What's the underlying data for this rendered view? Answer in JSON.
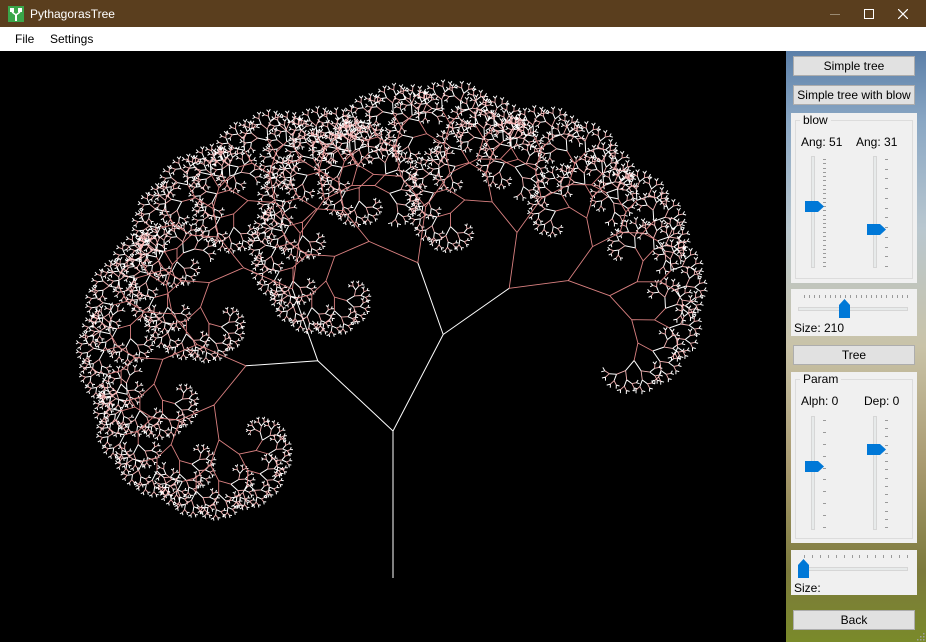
{
  "window": {
    "title": "PythagorasTree",
    "icon": "tree-app-icon",
    "controls": [
      "minimize-icon",
      "maximize-icon",
      "close-icon"
    ]
  },
  "menu": {
    "file": "File",
    "settings": "Settings"
  },
  "canvas": {
    "background": "#000000",
    "tree_colors": [
      "#ffffff",
      "#f4b4b4",
      "#d98080"
    ]
  },
  "panel": {
    "simple_tree_button": "Simple tree",
    "simple_tree_blow_button": "Simple tree with blow",
    "blow_group": {
      "title": "blow",
      "angle1_label": "Ang: 51",
      "angle2_label": "Ang: 31"
    },
    "blow_size_label": "Size: 210",
    "tree_button": "Tree",
    "param_group": {
      "title": "Param",
      "alpha_label": "Alph: 0",
      "depth_label": "Dep: 0"
    },
    "param_size_label": "Size:",
    "back_button": "Back"
  },
  "colors": {
    "accent": "#0078d7",
    "titlebar": "#5a3e1e",
    "button_face": "#e1e1e1"
  }
}
